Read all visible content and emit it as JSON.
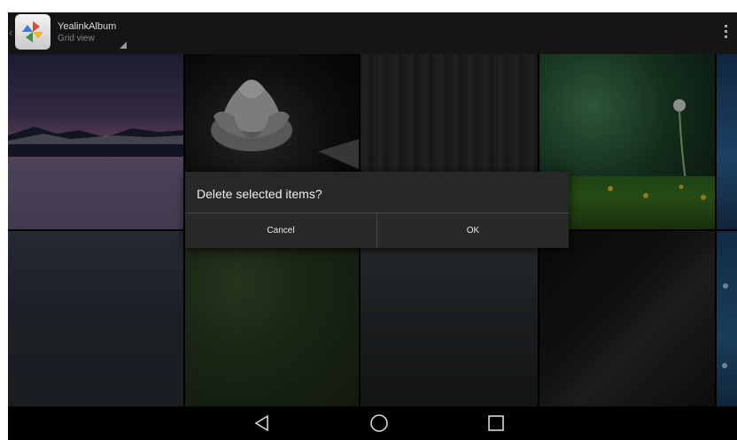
{
  "actionbar": {
    "app_title": "YealinkAlbum",
    "view_mode": "Grid view",
    "icons": {
      "app": "album-app-icon",
      "overflow": "overflow-menu-icon",
      "up": "up-caret-icon"
    }
  },
  "dialog": {
    "message": "Delete selected items?",
    "cancel_label": "Cancel",
    "ok_label": "OK"
  },
  "navbar": {
    "icons": [
      "back-icon",
      "home-icon",
      "recent-apps-icon"
    ]
  },
  "colors": {
    "dialog_bg": "#282828",
    "actionbar_bg": "#151515"
  }
}
